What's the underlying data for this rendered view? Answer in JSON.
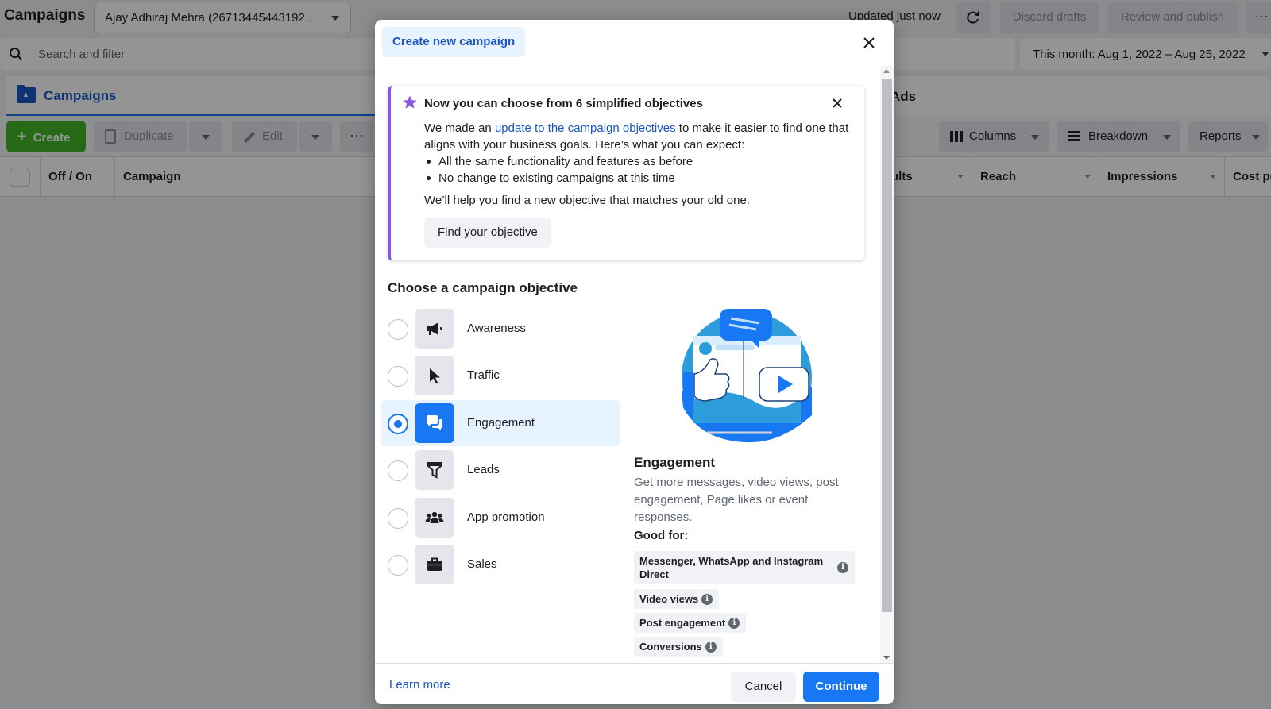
{
  "app": {
    "title": "Campaigns",
    "account": "Ajay Adhiraj Mehra (26713445443192…",
    "updated": "Updated just now",
    "discard_label": "Discard drafts",
    "review_label": "Review and publish",
    "search_placeholder": "Search and filter",
    "date_range": "This month: Aug 1, 2022 – Aug 25, 2022",
    "tabs": {
      "campaigns": "Campaigns",
      "ads": "Ads"
    },
    "toolbar": {
      "create": "Create",
      "duplicate": "Duplicate",
      "edit": "Edit",
      "more": "···",
      "columns": "Columns",
      "breakdown": "Breakdown",
      "reports": "Reports"
    },
    "table_headers": {
      "off_on": "Off / On",
      "campaign": "Campaign",
      "results": "ults",
      "reach": "Reach",
      "impressions": "Impressions",
      "cost": "Cost pe"
    }
  },
  "modal": {
    "title": "Create new campaign",
    "notice": {
      "title": "Now you can choose from 6 simplified objectives",
      "text_before": "We made an ",
      "link": "update to the campaign objectives",
      "text_after": " to make it easier to find one that aligns with your business goals. Here’s what you can expect:",
      "bullets": [
        "All the same functionality and features as before",
        "No change to existing campaigns at this time"
      ],
      "help": "We’ll help you find a new objective that matches your old one.",
      "button": "Find your objective"
    },
    "section_title": "Choose a campaign objective",
    "objectives": [
      {
        "label": "Awareness",
        "icon": "megaphone-icon",
        "selected": false
      },
      {
        "label": "Traffic",
        "icon": "cursor-icon",
        "selected": false
      },
      {
        "label": "Engagement",
        "icon": "chat-bubbles-icon",
        "selected": true
      },
      {
        "label": "Leads",
        "icon": "funnel-icon",
        "selected": false
      },
      {
        "label": "App promotion",
        "icon": "people-icon",
        "selected": false
      },
      {
        "label": "Sales",
        "icon": "briefcase-icon",
        "selected": false
      }
    ],
    "detail": {
      "title": "Engagement",
      "description": "Get more messages, video views, post engagement, Page likes or event responses.",
      "good_for_label": "Good for:",
      "good_for": [
        "Messenger, WhatsApp and Instagram Direct",
        "Video views",
        "Post engagement",
        "Conversions"
      ]
    },
    "footer": {
      "learn_more": "Learn more",
      "cancel": "Cancel",
      "continue": "Continue"
    }
  },
  "colors": {
    "primary": "#1877f2",
    "link": "#1a56c4",
    "create_green": "#42b72a",
    "notice_accent": "#8a56db"
  }
}
